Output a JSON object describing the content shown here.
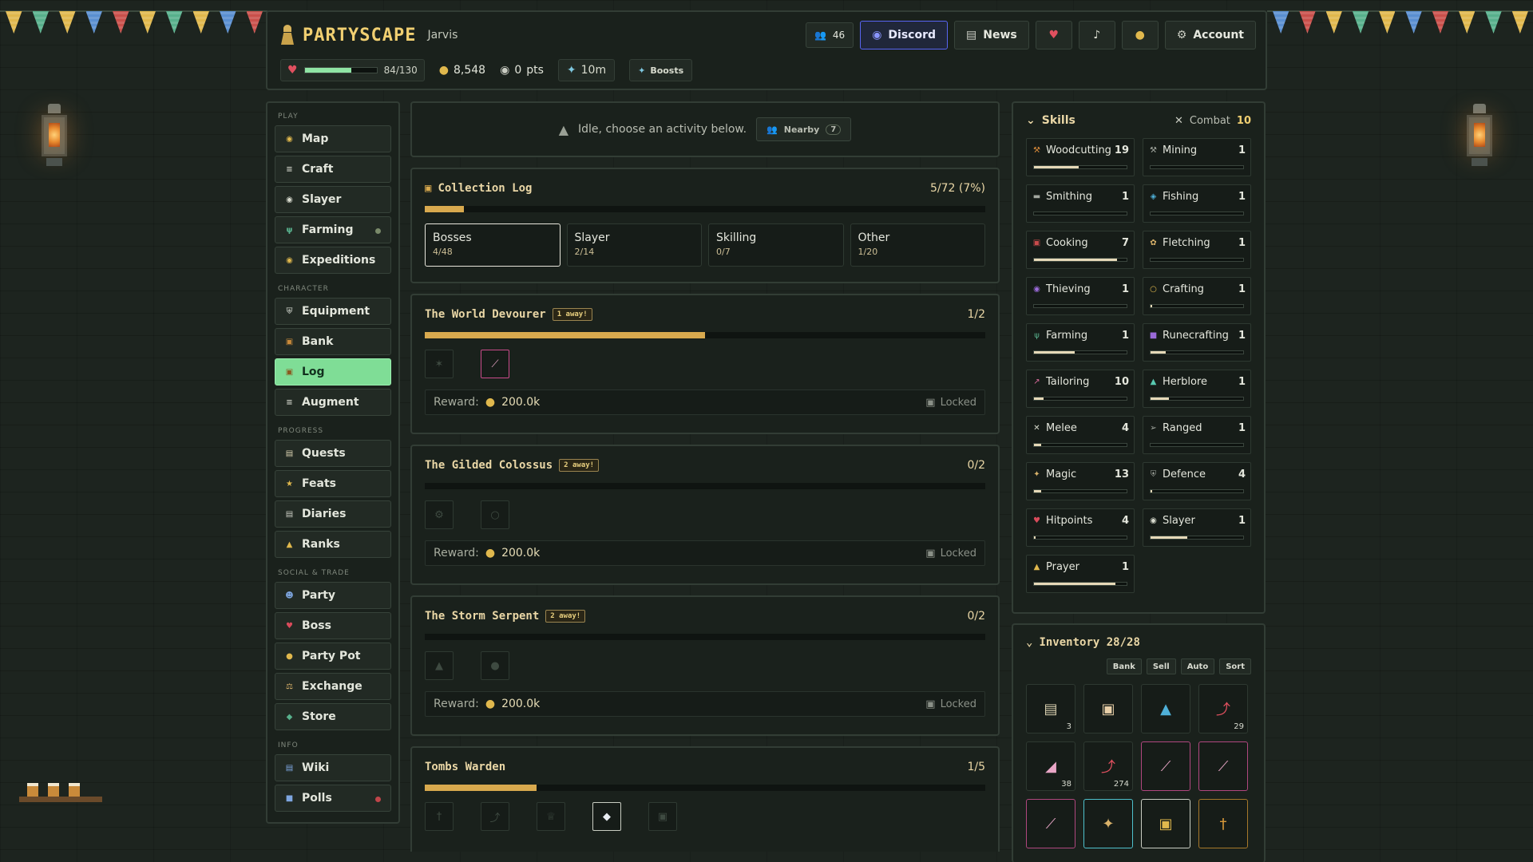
{
  "colors": {
    "accent_gold": "#f0cf71",
    "active_nav": "#7fdd96",
    "progress": "#d8a94e",
    "hp_bar": "#8fe4a4",
    "discord": "#5865f2",
    "bunting": [
      "#e0b84d",
      "#58b08c",
      "#e0b84d",
      "#5a8fd0",
      "#c9504b",
      "#e0b84d",
      "#58b08c",
      "#e0b84d",
      "#5a8fd0",
      "#c9504b"
    ]
  },
  "header": {
    "brand": "PARTYSCAPE",
    "username": "Jarvis",
    "brand_icon": "wizard-icon",
    "online_count": "46",
    "discord_label": "Discord",
    "news_label": "News",
    "account_label": "Account",
    "hp_text": "84/130",
    "hp_fraction": 0.646,
    "gold": "8,548",
    "points": "0",
    "points_unit": "pts",
    "boost_time": "10m",
    "boosts_label": "Boosts"
  },
  "sidebar": {
    "sections": [
      {
        "title": "PLAY",
        "items": [
          {
            "label": "Map",
            "icon": "map-icon"
          },
          {
            "label": "Craft",
            "icon": "hammer-icon"
          },
          {
            "label": "Slayer",
            "icon": "skull-icon"
          },
          {
            "label": "Farming",
            "icon": "sprout-icon",
            "dot": "#7a8a6a"
          },
          {
            "label": "Expeditions",
            "icon": "compass-icon"
          }
        ]
      },
      {
        "title": "CHARACTER",
        "items": [
          {
            "label": "Equipment",
            "icon": "shield-icon"
          },
          {
            "label": "Bank",
            "icon": "chest-icon"
          },
          {
            "label": "Log",
            "icon": "book-icon",
            "active": true
          },
          {
            "label": "Augment",
            "icon": "hammer-icon"
          }
        ]
      },
      {
        "title": "PROGRESS",
        "items": [
          {
            "label": "Quests",
            "icon": "scroll-icon"
          },
          {
            "label": "Feats",
            "icon": "star-icon"
          },
          {
            "label": "Diaries",
            "icon": "journal-icon"
          },
          {
            "label": "Ranks",
            "icon": "trophy-icon"
          }
        ]
      },
      {
        "title": "SOCIAL & TRADE",
        "items": [
          {
            "label": "Party",
            "icon": "people-icon"
          },
          {
            "label": "Boss",
            "icon": "demon-icon"
          },
          {
            "label": "Party Pot",
            "icon": "coins-icon"
          },
          {
            "label": "Exchange",
            "icon": "scales-icon"
          },
          {
            "label": "Store",
            "icon": "gem-icon"
          }
        ]
      },
      {
        "title": "INFO",
        "items": [
          {
            "label": "Wiki",
            "icon": "open-book-icon"
          },
          {
            "label": "Polls",
            "icon": "chat-icon",
            "dot": "#c0454a"
          }
        ]
      }
    ]
  },
  "activity": {
    "status": "Idle, choose an activity below.",
    "nearby_label": "Nearby",
    "nearby_count": "7"
  },
  "collection_log": {
    "title": "Collection Log",
    "progress_text": "5/72 (7%)",
    "progress_fraction": 0.07,
    "tabs": [
      {
        "label": "Bosses",
        "count": "4/48",
        "active": true
      },
      {
        "label": "Slayer",
        "count": "2/14"
      },
      {
        "label": "Skilling",
        "count": "0/7"
      },
      {
        "label": "Other",
        "count": "1/20"
      }
    ]
  },
  "bosses": [
    {
      "name": "The World Devourer",
      "badge": "1 away!",
      "count": "1/2",
      "fraction": 0.5,
      "reward_label": "Reward:",
      "reward": "200.0k",
      "status": "Locked",
      "slots": [
        {
          "icon": "claw-icon",
          "got": false
        },
        {
          "icon": "staff-icon",
          "got": true
        }
      ]
    },
    {
      "name": "The Gilded Colossus",
      "badge": "2 away!",
      "count": "0/2",
      "fraction": 0,
      "reward_label": "Reward:",
      "reward": "200.0k",
      "status": "Locked",
      "slots": [
        {
          "icon": "gear-icon",
          "got": false
        },
        {
          "icon": "ring-icon",
          "got": false
        }
      ]
    },
    {
      "name": "The Storm Serpent",
      "badge": "2 away!",
      "count": "0/2",
      "fraction": 0,
      "reward_label": "Reward:",
      "reward": "200.0k",
      "status": "Locked",
      "slots": [
        {
          "icon": "helm-icon",
          "got": false
        },
        {
          "icon": "orb-icon",
          "got": false
        }
      ]
    },
    {
      "name": "Tombs Warden",
      "badge": "",
      "count": "1/5",
      "fraction": 0.2,
      "reward_label": "",
      "reward": "",
      "status": "",
      "slots": [
        {
          "icon": "dagger-icon",
          "got": false
        },
        {
          "icon": "scythe-icon",
          "got": false
        },
        {
          "icon": "crown-icon",
          "got": false
        },
        {
          "icon": "diamond-icon",
          "got": true
        },
        {
          "icon": "chest-icon",
          "got": false
        }
      ]
    }
  ],
  "skills": {
    "title": "Skills",
    "combat_label": "Combat",
    "combat_level": "10",
    "list": [
      {
        "name": "Woodcutting",
        "level": "19",
        "fraction": 0.48,
        "icon": "axe-icon",
        "color": "#d98a3a"
      },
      {
        "name": "Mining",
        "level": "1",
        "fraction": 0.0,
        "icon": "pickaxe-icon",
        "color": "#a3a8a0"
      },
      {
        "name": "Smithing",
        "level": "1",
        "fraction": 0.0,
        "icon": "anvil-icon",
        "color": "#a3a8a0"
      },
      {
        "name": "Fishing",
        "level": "1",
        "fraction": 0.0,
        "icon": "fish-icon",
        "color": "#4fb0d8"
      },
      {
        "name": "Cooking",
        "level": "7",
        "fraction": 0.9,
        "icon": "pot-icon",
        "color": "#c94b4b"
      },
      {
        "name": "Fletching",
        "level": "1",
        "fraction": 0.0,
        "icon": "feather-icon",
        "color": "#d9b26a"
      },
      {
        "name": "Thieving",
        "level": "1",
        "fraction": 0.0,
        "icon": "mask-icon",
        "color": "#9a6ad8"
      },
      {
        "name": "Crafting",
        "level": "1",
        "fraction": 0.02,
        "icon": "ring-icon",
        "color": "#e0b84d"
      },
      {
        "name": "Farming",
        "level": "1",
        "fraction": 0.44,
        "icon": "sprout-icon",
        "color": "#58b08c"
      },
      {
        "name": "Runecrafting",
        "level": "1",
        "fraction": 0.16,
        "icon": "rune-icon",
        "color": "#9a6ad8"
      },
      {
        "name": "Tailoring",
        "level": "10",
        "fraction": 0.1,
        "icon": "needle-icon",
        "color": "#d86a9a"
      },
      {
        "name": "Herblore",
        "level": "1",
        "fraction": 0.2,
        "icon": "flask-icon",
        "color": "#58c8b0"
      },
      {
        "name": "Melee",
        "level": "4",
        "fraction": 0.08,
        "icon": "swords-icon",
        "color": "#d9dccf"
      },
      {
        "name": "Ranged",
        "level": "1",
        "fraction": 0.0,
        "icon": "bow-icon",
        "color": "#a3a8a0"
      },
      {
        "name": "Magic",
        "level": "13",
        "fraction": 0.08,
        "icon": "wand-icon",
        "color": "#d9b26a"
      },
      {
        "name": "Defence",
        "level": "4",
        "fraction": 0.02,
        "icon": "shield-icon",
        "color": "#a3a8a0"
      },
      {
        "name": "Hitpoints",
        "level": "4",
        "fraction": 0.02,
        "icon": "heart-icon",
        "color": "#d94b5b"
      },
      {
        "name": "Slayer",
        "level": "1",
        "fraction": 0.4,
        "icon": "skull-icon",
        "color": "#d9dccf"
      },
      {
        "name": "Prayer",
        "level": "1",
        "fraction": 0.88,
        "icon": "candle-icon",
        "color": "#e0b84d"
      }
    ]
  },
  "inventory": {
    "title": "Inventory 28/28",
    "buttons": [
      "Bank",
      "Sell",
      "Auto",
      "Sort"
    ],
    "items": [
      {
        "icon": "scroll-icon",
        "qty": "3",
        "border": ""
      },
      {
        "icon": "box-icon",
        "qty": "",
        "border": ""
      },
      {
        "icon": "potion-icon",
        "qty": "",
        "border": ""
      },
      {
        "icon": "shrimp-icon",
        "qty": "29",
        "border": ""
      },
      {
        "icon": "boot-icon",
        "qty": "38",
        "border": ""
      },
      {
        "icon": "shrimp-icon",
        "qty": "274",
        "border": ""
      },
      {
        "icon": "staff-icon",
        "qty": "",
        "border": "pink"
      },
      {
        "icon": "staff-icon",
        "qty": "",
        "border": "pink"
      },
      {
        "icon": "staff-icon",
        "qty": "",
        "border": "pink"
      },
      {
        "icon": "wand-icon",
        "qty": "",
        "border": "cyan"
      },
      {
        "icon": "bag-icon",
        "qty": "",
        "border": "white"
      },
      {
        "icon": "dagger-icon",
        "qty": "",
        "border": "amber"
      }
    ]
  }
}
